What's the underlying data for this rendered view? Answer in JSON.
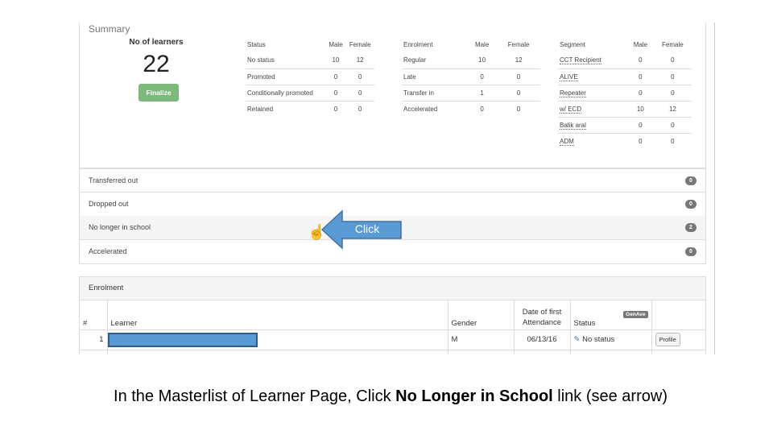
{
  "summary": {
    "title": "Summary",
    "learners_label": "No of learners",
    "learners_count": "22",
    "finalize": "Finalize",
    "status_table": {
      "headers": [
        "Status",
        "Male",
        "Female"
      ],
      "rows": [
        [
          "No status",
          "10",
          "12"
        ],
        [
          "Promoted",
          "0",
          "0"
        ],
        [
          "Conditionally promoted",
          "0",
          "0"
        ],
        [
          "Retained",
          "0",
          "0"
        ]
      ]
    },
    "enrolment_table": {
      "headers": [
        "Enrolment",
        "Male",
        "Female"
      ],
      "rows": [
        [
          "Regular",
          "10",
          "12"
        ],
        [
          "Late",
          "0",
          "0"
        ],
        [
          "Transfer in",
          "1",
          "0"
        ],
        [
          "Accelerated",
          "0",
          "0"
        ]
      ]
    },
    "segment_table": {
      "headers": [
        "Segment",
        "Male",
        "Female"
      ],
      "rows": [
        [
          "CCT Recipient",
          "0",
          "0"
        ],
        [
          "ALIVE",
          "0",
          "0"
        ],
        [
          "Repeater",
          "0",
          "0"
        ],
        [
          "w/ ECD",
          "10",
          "12"
        ],
        [
          "Balik aral",
          "0",
          "0"
        ],
        [
          "ADM",
          "0",
          "0"
        ]
      ]
    }
  },
  "list": [
    {
      "label": "Transferred out",
      "count": "0"
    },
    {
      "label": "Dropped out",
      "count": "0"
    },
    {
      "label": "No longer in school",
      "count": "2"
    },
    {
      "label": "Accelerated",
      "count": "0"
    }
  ],
  "enrolment": {
    "title": "Enrolment",
    "headers": {
      "num": "#",
      "learner": "Learner",
      "gender": "Gender",
      "date": "Date of first Attendance",
      "status": "Status",
      "genave": "GenAve"
    },
    "rows": [
      {
        "num": "1",
        "gender": "M",
        "date": "06/13/16",
        "status": "No status",
        "action": "Profile"
      }
    ]
  },
  "callout": {
    "text": "Click",
    "color": "#5b9bd5"
  },
  "caption": {
    "pre": "In the Masterlist of Learner Page, Click ",
    "bold": "No Longer in School",
    "post": " link (see arrow)"
  }
}
